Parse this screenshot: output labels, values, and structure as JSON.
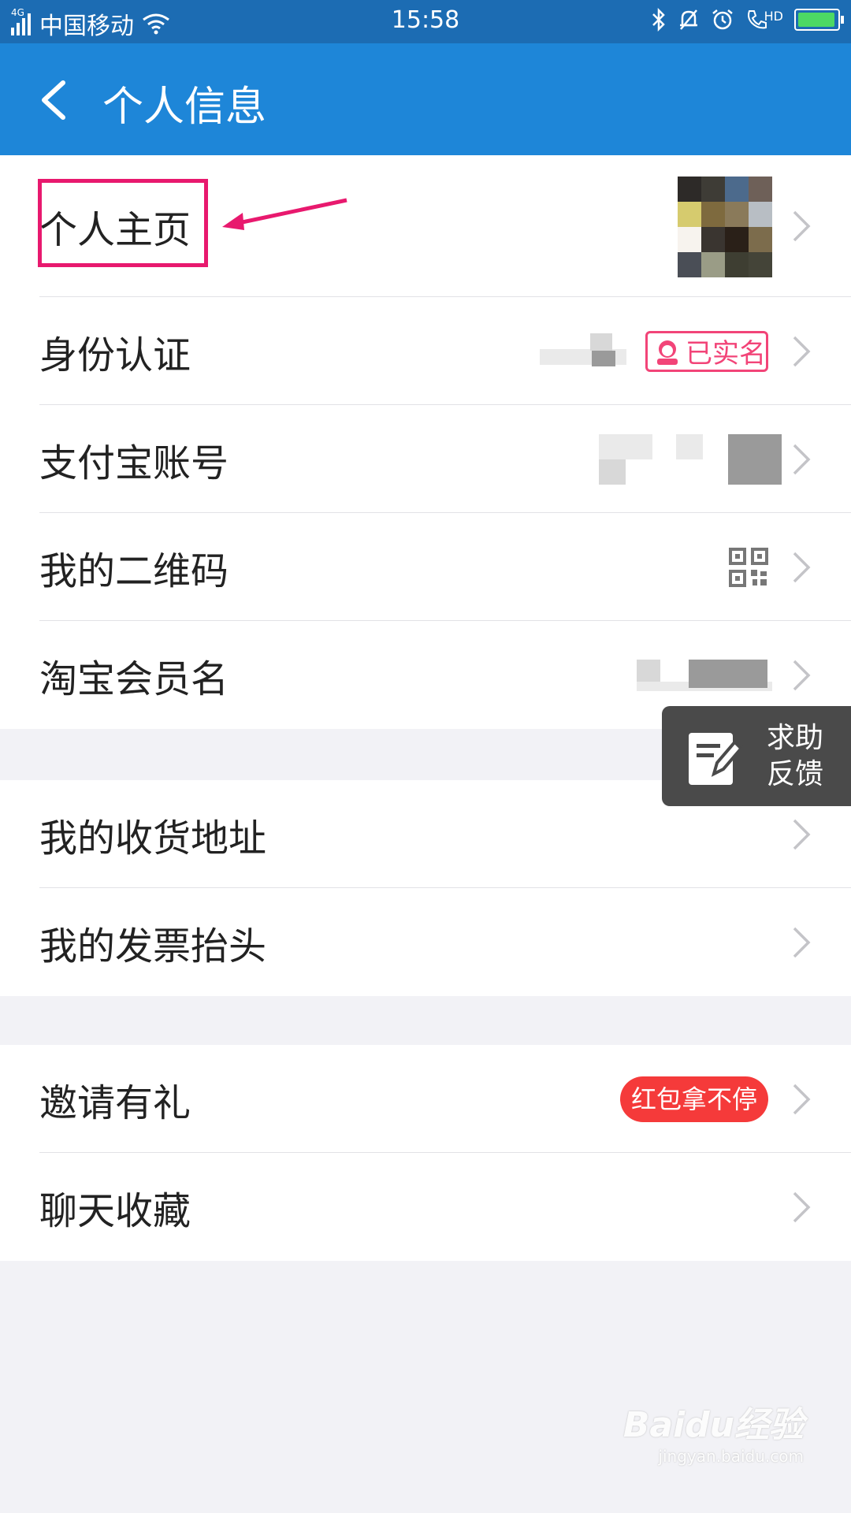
{
  "status_bar": {
    "network": "4G",
    "carrier": "中国移动",
    "time": "15:58",
    "hd_tag": "HD"
  },
  "header": {
    "title": "个人信息"
  },
  "group1": {
    "items": [
      {
        "label": "个人主页"
      },
      {
        "label": "身份认证",
        "badge": "已实名"
      },
      {
        "label": "支付宝账号"
      },
      {
        "label": "我的二维码"
      },
      {
        "label": "淘宝会员名"
      }
    ]
  },
  "group2": {
    "items": [
      {
        "label": "我的收货地址"
      },
      {
        "label": "我的发票抬头"
      }
    ]
  },
  "group3": {
    "items": [
      {
        "label": "邀请有礼",
        "badge": "红包拿不停"
      },
      {
        "label": "聊天收藏"
      }
    ]
  },
  "help_button": {
    "line1": "求助",
    "line2": "反馈"
  },
  "watermark": {
    "brand": "Baidu经验",
    "url": "jingyan.baidu.com"
  },
  "colors": {
    "status_bar": "#1c6cb3",
    "title_bar": "#1e86d8",
    "highlight": "#e8196e",
    "verified": "#f24478",
    "red_badge": "#f53a3a"
  }
}
